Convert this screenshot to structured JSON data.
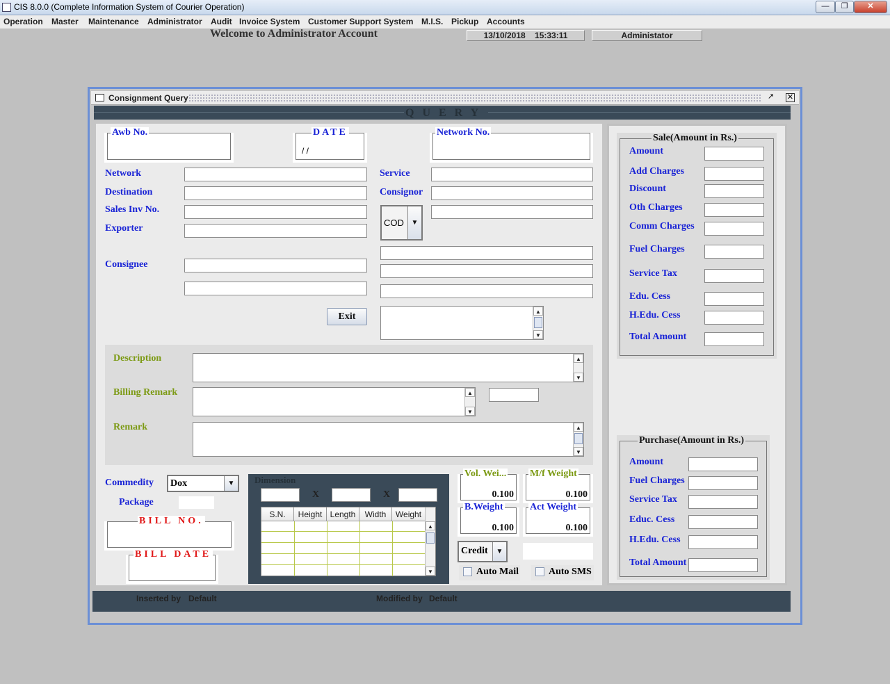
{
  "app": {
    "title": "CIS 8.0.0 (Complete Information System of Courier Operation)"
  },
  "menus": [
    "Operation",
    "Master",
    "Maintenance",
    "Administrator",
    "Audit",
    "Invoice System",
    "Customer Support System",
    "M.I.S.",
    "Pickup",
    "Accounts"
  ],
  "header": {
    "welcome": "Welcome to Administrator Account",
    "date": "13/10/2018",
    "time": "15:33:11",
    "user": "Administator"
  },
  "window": {
    "title": "Consignment Query",
    "band": "QUERY"
  },
  "form": {
    "awb_label": "Awb No.",
    "date_label": "DATE",
    "date_value": "/ /",
    "network_no_label": "Network No.",
    "network_label": "Network",
    "destination_label": "Destination",
    "sales_inv_label": "Sales Inv No.",
    "exporter_label": "Exporter",
    "consignee_label": "Consignee",
    "service_label": "Service",
    "consignor_label": "Consignor",
    "cod_value": "COD",
    "exit_label": "Exit",
    "description_label": "Description",
    "billing_remark_label": "Billing Remark",
    "remark_label": "Remark",
    "commodity_label": "Commedity",
    "commodity_value": "Dox",
    "package_label": "Package",
    "bill_no_label": "BILL NO.",
    "bill_date_label": "BILL DATE",
    "dimension_label": "Dimension",
    "x_sep": "X",
    "dim_columns": [
      "S.N.",
      "Height",
      "Length",
      "Width",
      "Weight"
    ],
    "vol_weight_label": "Vol. Wei...",
    "vol_weight_value": "0.100",
    "mf_weight_label": "M/f Weight",
    "mf_weight_value": "0.100",
    "b_weight_label": "B.Weight",
    "b_weight_value": "0.100",
    "act_weight_label": "Act Weight",
    "act_weight_value": "0.100",
    "payment_value": "Credit",
    "auto_mail_label": "Auto Mail",
    "auto_sms_label": "Auto SMS"
  },
  "sale": {
    "title": "Sale(Amount in Rs.)",
    "items": [
      "Amount",
      "Add Charges",
      "Discount",
      "Oth Charges",
      "Comm Charges",
      "Fuel Charges",
      "Service Tax",
      "Edu. Cess",
      "H.Edu. Cess",
      "Total Amount"
    ]
  },
  "purchase": {
    "title": "Purchase(Amount in Rs.)",
    "items": [
      "Amount",
      "Fuel Charges",
      "Service Tax",
      "Educ. Cess",
      "H.Edu. Cess",
      "Total Amount"
    ]
  },
  "footer": {
    "inserted_label": "Inserted by",
    "inserted_value": "Default",
    "modified_label": "Modified by",
    "modified_value": "Default"
  }
}
